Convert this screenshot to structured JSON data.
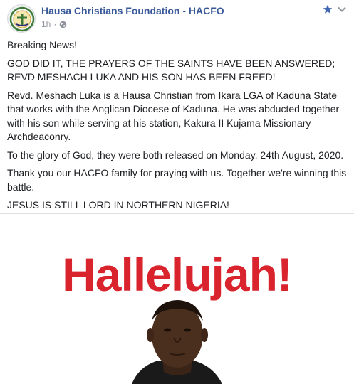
{
  "post": {
    "page_name": "Hausa Christians Foundation - HACFO",
    "time": "1h",
    "separator": "·",
    "paragraphs": [
      "Breaking News!",
      "GOD DID IT, THE PRAYERS OF THE SAINTS HAVE BEEN ANSWERED; REVD MESHACH LUKA AND HIS SON HAS BEEN FREED!",
      "Revd. Meshach Luka is a Hausa Christian from Ikara LGA of Kaduna State that works with the Anglican Diocese of Kaduna. He was abducted together with his son while serving at his station, Kakura II Kujama Missionary Archdeaconry.",
      "To the glory of God, they were both released on Monday, 24th August, 2020.",
      "Thank you our HACFO family for praying with us. Together we're winning this battle.",
      "JESUS IS STILL LORD IN NORTHERN NIGERIA!"
    ]
  },
  "image": {
    "headline": "Hallelujah!"
  },
  "colors": {
    "page_name": "#385898",
    "meta": "#90949c",
    "headline": "#d9232d",
    "star": "#4267b2"
  },
  "icons": {
    "avatar": "hacfo-logo-avatar",
    "audience": "globe-icon",
    "favorite": "star-icon",
    "options": "chevron-down-icon"
  }
}
